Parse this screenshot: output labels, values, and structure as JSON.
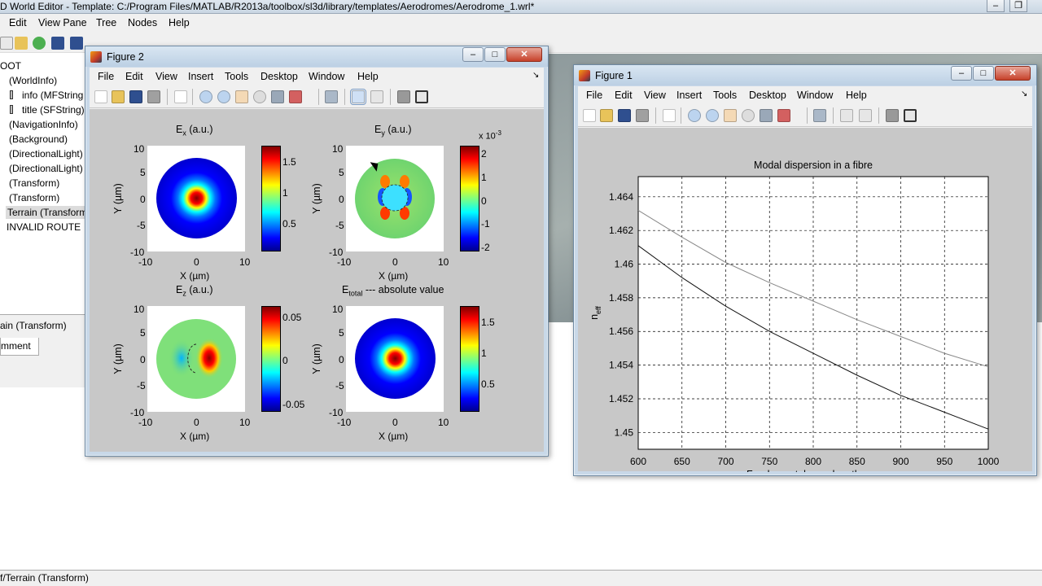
{
  "world_editor": {
    "title": "D World Editor - Template: C:/Program Files/MATLAB/R2013a/toolbox/sl3d/library/templates/Aerodromes/Aerodrome_1.wrl*",
    "menu": [
      "Edit",
      "View Pane",
      "Tree",
      "Nodes",
      "Help"
    ],
    "tree": [
      {
        "label": "OOT",
        "indent": 0
      },
      {
        "label": "(WorldInfo)",
        "indent": 1
      },
      {
        "label": "info (MFString",
        "indent": 2
      },
      {
        "label": "title (SFString):",
        "indent": 2
      },
      {
        "label": "(NavigationInfo)",
        "indent": 1
      },
      {
        "label": "(Background)",
        "indent": 1
      },
      {
        "label": "(DirectionalLight)",
        "indent": 1
      },
      {
        "label": "(DirectionalLight)",
        "indent": 1
      },
      {
        "label": "(Transform)",
        "indent": 1
      },
      {
        "label": "(Transform)",
        "indent": 1
      },
      {
        "label": "Terrain (Transform",
        "indent": 1,
        "selected": true
      },
      {
        "label": "INVALID ROUTE",
        "indent": 1
      }
    ],
    "lower_panel_title": "ain (Transform)",
    "lower_panel_tab": "mment",
    "status": "f/Terrain (Transform)"
  },
  "figure2": {
    "title": "Figure 2",
    "menu": [
      "File",
      "Edit",
      "View",
      "Insert",
      "Tools",
      "Desktop",
      "Window",
      "Help"
    ],
    "plots": {
      "ex": {
        "title": "E",
        "sub": "x",
        "rest": " (a.u.)",
        "cbar_ticks": [
          "1.5",
          "1",
          "0.5"
        ]
      },
      "ey": {
        "title": "E",
        "sub": "y",
        "rest": " (a.u.)",
        "cbar_ticks": [
          "2",
          "1",
          "0",
          "-1",
          "-2"
        ],
        "exponent": "x 10",
        "exponent_power": "-3"
      },
      "ez": {
        "title": "E",
        "sub": "z",
        "rest": " (a.u.)",
        "cbar_ticks": [
          "0.05",
          "0",
          "-0.05"
        ]
      },
      "et": {
        "title": "E",
        "sub": "total",
        "rest": " --- absolute value",
        "cbar_ticks": [
          "1.5",
          "1",
          "0.5"
        ]
      }
    },
    "x_ticks": [
      "-10",
      "0",
      "10"
    ],
    "y_ticks": [
      "10",
      "5",
      "0",
      "-5",
      "-10"
    ],
    "xlabel": "X (µm)",
    "ylabel": "Y (µm)"
  },
  "figure1": {
    "title": "Figure 1",
    "menu": [
      "File",
      "Edit",
      "View",
      "Insert",
      "Tools",
      "Desktop",
      "Window",
      "Help"
    ]
  },
  "chart_data": {
    "type": "line",
    "title": "Modal dispersion in a fibre",
    "xlabel": "Fundamental wavelength, nm",
    "ylabel": "n",
    "ylabel_sub": "eff",
    "xlim": [
      600,
      1000
    ],
    "ylim": [
      1.449,
      1.4652
    ],
    "x_ticks": [
      600,
      650,
      700,
      750,
      800,
      850,
      900,
      950,
      1000
    ],
    "y_ticks": [
      1.45,
      1.452,
      1.454,
      1.456,
      1.458,
      1.46,
      1.462,
      1.464
    ],
    "y_tick_labels": [
      "1.45",
      "1.452",
      "1.454",
      "1.456",
      "1.458",
      "1.46",
      "1.462",
      "1.464"
    ],
    "grid": true,
    "x": [
      600,
      650,
      700,
      750,
      800,
      850,
      900,
      950,
      1000
    ],
    "series": [
      {
        "values": [
          1.4632,
          1.4616,
          1.4601,
          1.4589,
          1.4578,
          1.4567,
          1.4557,
          1.4547,
          1.4539
        ],
        "color": "#888888"
      },
      {
        "values": [
          1.4611,
          1.4592,
          1.4575,
          1.456,
          1.4547,
          1.4534,
          1.4522,
          1.4512,
          1.4502
        ],
        "color": "#111111"
      }
    ]
  }
}
